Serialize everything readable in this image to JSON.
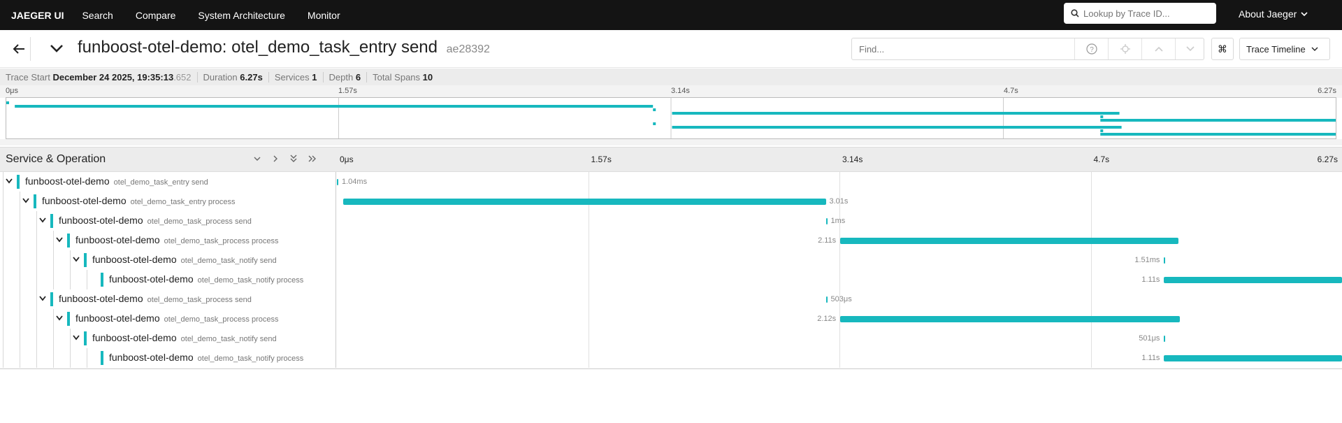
{
  "nav": {
    "brand": "JAEGER UI",
    "links": [
      "Search",
      "Compare",
      "System Architecture",
      "Monitor"
    ],
    "lookup_placeholder": "Lookup by Trace ID...",
    "about": "About Jaeger"
  },
  "header": {
    "title": "funboost-otel-demo: otel_demo_task_entry send",
    "trace_id": "ae28392",
    "find_placeholder": "Find...",
    "cmd_symbol": "⌘",
    "view_label": "Trace Timeline"
  },
  "summary": {
    "trace_start_label": "Trace Start",
    "trace_start_value": "December 24 2025, 19:35:13",
    "trace_start_ms": ".652",
    "duration_label": "Duration",
    "duration_value": "6.27s",
    "services_label": "Services",
    "services_value": "1",
    "depth_label": "Depth",
    "depth_value": "6",
    "spans_label": "Total Spans",
    "spans_value": "10"
  },
  "ticks": [
    "0μs",
    "1.57s",
    "3.14s",
    "4.7s",
    "6.27s"
  ],
  "timeline_header": {
    "title": "Service & Operation"
  },
  "colors": {
    "span": "#17b8be",
    "nav_bg": "#141414"
  },
  "spans": [
    {
      "service": "funboost-otel-demo",
      "operation": "otel_demo_task_entry send",
      "depth": 0,
      "toggle": true,
      "start_s": 0.0,
      "duration_s": 0.00104,
      "duration_label": "1.04ms",
      "label_side": "right"
    },
    {
      "service": "funboost-otel-demo",
      "operation": "otel_demo_task_entry process",
      "depth": 1,
      "toggle": true,
      "start_s": 0.04,
      "duration_s": 3.01,
      "duration_label": "3.01s",
      "label_side": "right"
    },
    {
      "service": "funboost-otel-demo",
      "operation": "otel_demo_task_process send",
      "depth": 2,
      "toggle": true,
      "start_s": 3.05,
      "duration_s": 0.001,
      "duration_label": "1ms",
      "label_side": "right"
    },
    {
      "service": "funboost-otel-demo",
      "operation": "otel_demo_task_process process",
      "depth": 3,
      "toggle": true,
      "start_s": 3.14,
      "duration_s": 2.11,
      "duration_label": "2.11s",
      "label_side": "left"
    },
    {
      "service": "funboost-otel-demo",
      "operation": "otel_demo_task_notify send",
      "depth": 4,
      "toggle": true,
      "start_s": 5.16,
      "duration_s": 0.00151,
      "duration_label": "1.51ms",
      "label_side": "left"
    },
    {
      "service": "funboost-otel-demo",
      "operation": "otel_demo_task_notify process",
      "depth": 5,
      "toggle": false,
      "start_s": 5.16,
      "duration_s": 1.11,
      "duration_label": "1.11s",
      "label_side": "left"
    },
    {
      "service": "funboost-otel-demo",
      "operation": "otel_demo_task_process send",
      "depth": 2,
      "toggle": true,
      "start_s": 3.05,
      "duration_s": 0.000503,
      "duration_label": "503μs",
      "label_side": "right"
    },
    {
      "service": "funboost-otel-demo",
      "operation": "otel_demo_task_process process",
      "depth": 3,
      "toggle": true,
      "start_s": 3.14,
      "duration_s": 2.12,
      "duration_label": "2.12s",
      "label_side": "left"
    },
    {
      "service": "funboost-otel-demo",
      "operation": "otel_demo_task_notify send",
      "depth": 4,
      "toggle": true,
      "start_s": 5.16,
      "duration_s": 0.000501,
      "duration_label": "501μs",
      "label_side": "left"
    },
    {
      "service": "funboost-otel-demo",
      "operation": "otel_demo_task_notify process",
      "depth": 5,
      "toggle": false,
      "start_s": 5.16,
      "duration_s": 1.11,
      "duration_label": "1.11s",
      "label_side": "left"
    }
  ],
  "total_duration_s": 6.27
}
